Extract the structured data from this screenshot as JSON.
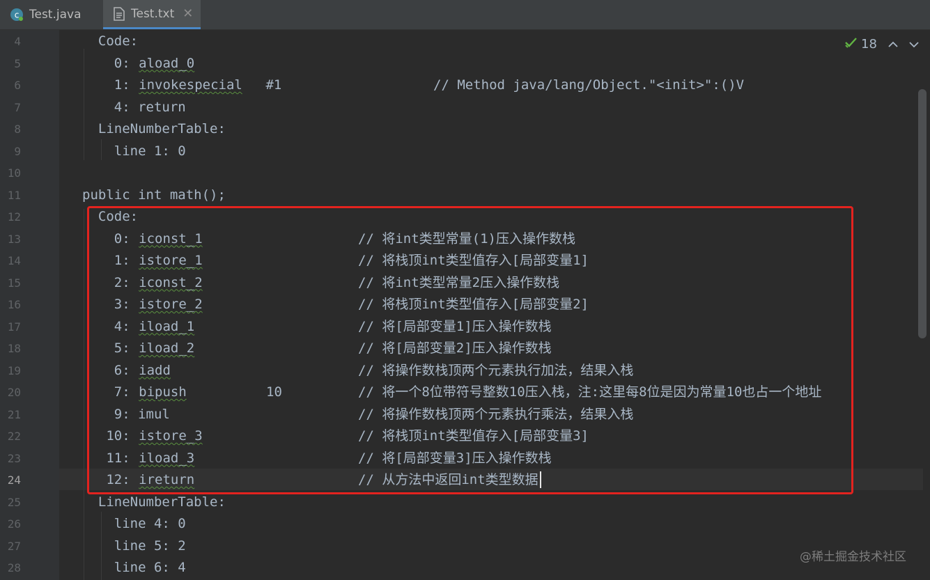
{
  "tabs": [
    {
      "label": "Test.java",
      "icon": "java-class-icon",
      "active": false
    },
    {
      "label": "Test.txt",
      "icon": "text-file-icon",
      "active": true,
      "close": "✕"
    }
  ],
  "inspection": {
    "count": "18",
    "up": "⌃",
    "down": "⌄"
  },
  "lines": [
    {
      "n": "4",
      "code": "  Code:"
    },
    {
      "n": "5",
      "code": "    0: ",
      "instr": "aload_0"
    },
    {
      "n": "6",
      "code": "    1: ",
      "instr": "invokespecial",
      "arg": " #1",
      "comment": "// Method java/lang/Object.\"<init>\":()V"
    },
    {
      "n": "7",
      "code": "    4: return"
    },
    {
      "n": "8",
      "code": "  LineNumberTable:"
    },
    {
      "n": "9",
      "code": "    line 1: 0"
    },
    {
      "n": "10",
      "code": ""
    },
    {
      "n": "11",
      "code": "public int math();"
    },
    {
      "n": "12",
      "code": "  Code:"
    },
    {
      "n": "13",
      "code": "    0: ",
      "instr": "iconst_1",
      "comment": "// 将int类型常量(1)压入操作数栈"
    },
    {
      "n": "14",
      "code": "    1: ",
      "instr": "istore_1",
      "comment": "// 将栈顶int类型值存入[局部变量1]"
    },
    {
      "n": "15",
      "code": "    2: ",
      "instr": "iconst_2",
      "comment": "// 将int类型常量2压入操作数栈"
    },
    {
      "n": "16",
      "code": "    3: ",
      "instr": "istore_2",
      "comment": "// 将栈顶int类型值存入[局部变量2]"
    },
    {
      "n": "17",
      "code": "    4: ",
      "instr": "iload_1",
      "comment": "// 将[局部变量1]压入操作数栈"
    },
    {
      "n": "18",
      "code": "    5: ",
      "instr": "iload_2",
      "comment": "// 将[局部变量2]压入操作数栈"
    },
    {
      "n": "19",
      "code": "    6: ",
      "instr": "iadd",
      "comment": "// 将操作数栈顶两个元素执行加法，结果入栈"
    },
    {
      "n": "20",
      "code": "    7: ",
      "instr": "bipush",
      "arg": "10",
      "comment": "// 将一个8位带符号整数10压入栈，注:这里每8位是因为常量10也占一个地址"
    },
    {
      "n": "21",
      "code": "    9: imul",
      "comment": "// 将操作数栈顶两个元素执行乘法，结果入栈"
    },
    {
      "n": "22",
      "code": "   10: ",
      "instr": "istore_3",
      "comment": "// 将栈顶int类型值存入[局部变量3]"
    },
    {
      "n": "23",
      "code": "   11: ",
      "instr": "iload_3",
      "comment": "// 将[局部变量3]压入操作数栈"
    },
    {
      "n": "24",
      "code": "   12: ",
      "instr": "ireturn",
      "comment": "// 从方法中返回int类型数据",
      "current": true
    },
    {
      "n": "25",
      "code": "  LineNumberTable:"
    },
    {
      "n": "26",
      "code": "    line 4: 0"
    },
    {
      "n": "27",
      "code": "    line 5: 2"
    },
    {
      "n": "28",
      "code": "    line 6: 4"
    }
  ],
  "watermark": "@稀土掘金技术社区",
  "colors": {
    "highlight_box": "#e3231f",
    "accent": "#4a88c7"
  }
}
